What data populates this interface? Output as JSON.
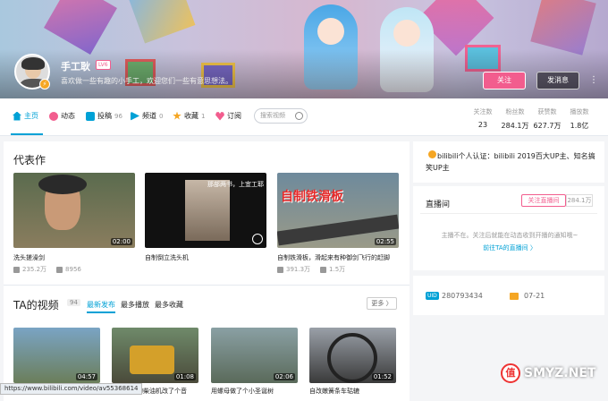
{
  "header": {
    "username": "手工耿",
    "level": "LV6",
    "signature": "喜欢做一些有趣的小手工，欢迎您们一些有意思想法。",
    "follow_label": "关注",
    "message_label": "发消息",
    "more_label": "⋮"
  },
  "nav": {
    "items": [
      {
        "label": "主页",
        "count": "",
        "icon": "home-icon",
        "color": "#00a1d6"
      },
      {
        "label": "动态",
        "count": "",
        "icon": "dynamic-icon",
        "color": "#f25d8e"
      },
      {
        "label": "投稿",
        "count": "96",
        "icon": "upload-icon",
        "color": "#00a1d6"
      },
      {
        "label": "频道",
        "count": "0",
        "icon": "channel-icon",
        "color": "#00a1d6"
      },
      {
        "label": "收藏",
        "count": "1",
        "icon": "star-icon",
        "color": "#f5a623"
      },
      {
        "label": "订阅",
        "count": "",
        "icon": "heart-icon",
        "color": "#f25d8e"
      }
    ],
    "search_placeholder": "搜索视频",
    "stats": [
      {
        "label": "关注数",
        "value": "23"
      },
      {
        "label": "粉丝数",
        "value": "284.1万"
      },
      {
        "label": "获赞数",
        "value": "627.7万"
      },
      {
        "label": "播放数",
        "value": "1.8亿"
      }
    ]
  },
  "masterpiece": {
    "title": "代表作",
    "videos": [
      {
        "title": "洗头搓澡剑",
        "duration": "02:00",
        "plays": "235.2万",
        "danmaku": "8956"
      },
      {
        "title": "自制倒立洗头机",
        "duration": "",
        "plays": "",
        "danmaku": "",
        "overlay": "那部两书，上宜工耶"
      },
      {
        "title": "自制铁滑板，滑起来有种御剑飞行的赶脚",
        "duration": "02:55",
        "plays": "391.3万",
        "danmaku": "1.5万",
        "overlay": "自制铁滑板"
      }
    ]
  },
  "ta_videos": {
    "title": "TA的视频",
    "count": "94",
    "tabs": [
      "最新发布",
      "最多播放",
      "最多收藏"
    ],
    "more_label": "更多 〉",
    "videos": [
      {
        "title": "",
        "duration": "04:57"
      },
      {
        "title": "家里不用的柴油机改了个音",
        "duration": "01:08"
      },
      {
        "title": "用螺母做了个小圣诞树",
        "duration": "02:06"
      },
      {
        "title": "自改嫩簧条车轱辘",
        "duration": "01:52"
      }
    ]
  },
  "side": {
    "auth_text": "bilibili个人认证：bilibili 2019百大UP主、知名搞笑UP主",
    "live_title": "直播间",
    "live_follow": "关注直播间",
    "live_count": "284.1万",
    "live_message": "主播不在。关注后就能在动态收到开播的通知哦~",
    "live_link": "前往TA的直播间 〉",
    "uid_label": "UID",
    "uid": "280793434",
    "birthday": "07-21"
  },
  "url": "https://www.bilibili.com/video/av55368614",
  "watermark": {
    "logo": "值",
    "text": "SMYZ.NET"
  }
}
